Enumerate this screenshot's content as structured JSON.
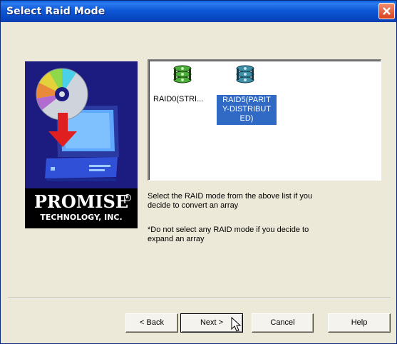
{
  "window": {
    "title": "Select Raid Mode"
  },
  "sidebar": {
    "brand": "PROMISE",
    "brand_sub": "TECHNOLOGY, INC.",
    "reg_mark": "R"
  },
  "raid_list": {
    "items": [
      {
        "label": "RAID0(STRI...",
        "icon": "disk-array-icon",
        "selected": false
      },
      {
        "label": "RAID5(PARITY-DISTRIBUTED)",
        "label_lines": [
          "RAID5(PARIT",
          "Y-DISTRIBUT",
          "ED)"
        ],
        "icon": "disk-array-icon",
        "selected": true
      }
    ]
  },
  "messages": {
    "line1a": "Select the RAID mode from the above list if you",
    "line1b": "decide to convert an array",
    "line2a": "*Do not select any RAID mode if you decide to",
    "line2b": "expand an array"
  },
  "buttons": {
    "back": "< Back",
    "next": "Next >",
    "cancel": "Cancel",
    "help": "Help"
  },
  "colors": {
    "title_bar": "#0a58d6",
    "selection": "#316ac5",
    "sidebar": "#1c1c80",
    "dialog_bg": "#ece9d8"
  }
}
